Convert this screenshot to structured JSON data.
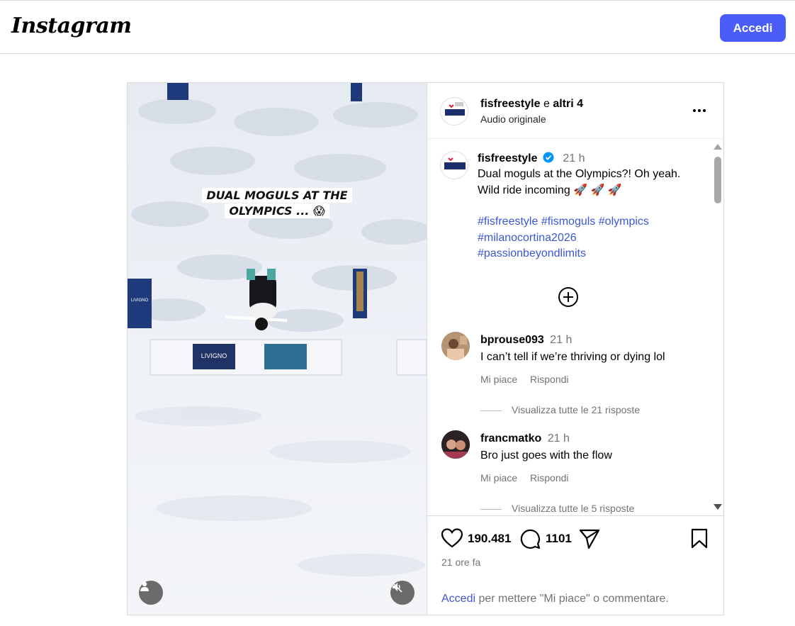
{
  "header": {
    "logo_text": "Instagram",
    "login_button": "Accedi"
  },
  "media": {
    "overlay_caption_line1": "DUAL MOGULS AT THE",
    "overlay_caption_line2": "OLYMPICS ... 😱",
    "banner_left": "LIVIGNO",
    "banner_side": "LIVIGNO",
    "user_button_icon": "user-icon",
    "mute_button_icon": "muted-speaker-icon"
  },
  "post_header": {
    "username": "fisfreestyle",
    "connector": "e",
    "others": "altri 4",
    "audio": "Audio originale",
    "more_icon": "more-icon"
  },
  "caption": {
    "username": "fisfreestyle",
    "time": "21 h",
    "text_line1": "Dual moguls at the Olympics?! Oh yeah.",
    "text_line2": "Wild ride incoming 🚀 🚀 🚀",
    "hashtags_line1": [
      "#fisfreestyle",
      "#fismoguls",
      "#olympics"
    ],
    "hashtags_line2": "#milanocortina2026",
    "hashtags_line3": "#passionbeyondlimits"
  },
  "comments": [
    {
      "username": "bprouse093",
      "time": "21 h",
      "text": "I can’t tell if we’re thriving or dying lol",
      "like": "Mi piace",
      "reply": "Rispondi",
      "view_replies": "Visualizza tutte le 21 risposte"
    },
    {
      "username": "francmatko",
      "time": "21 h",
      "text": "Bro just goes with the flow",
      "like": "Mi piace",
      "reply": "Rispondi",
      "view_replies": "Visualizza tutte le 5 risposte"
    }
  ],
  "actions": {
    "likes": "190.481",
    "comments": "1101",
    "time_ago": "21 ore fa",
    "login_link": "Accedi",
    "login_rest": "per mettere \"Mi piace\" o commentare."
  },
  "colors": {
    "accent": "#4a5df9",
    "link": "#3b57d6",
    "verified": "#0095f6",
    "muted": "#737373"
  }
}
